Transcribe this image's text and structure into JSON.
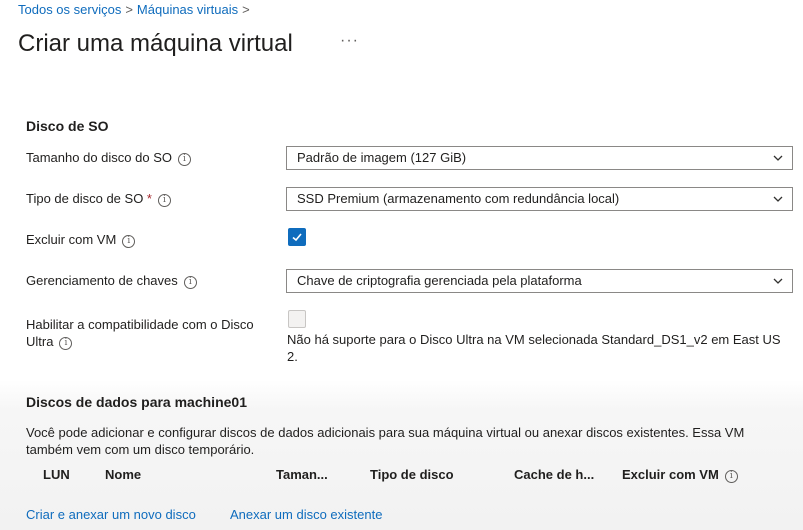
{
  "breadcrumb": [
    "Todos os serviços",
    "Máquinas virtuais"
  ],
  "page": {
    "title": "Criar uma máquina virtual",
    "more": "···"
  },
  "os_disk": {
    "section_title": "Disco de SO",
    "size_label": "Tamanho do disco do SO",
    "size_value": "Padrão de imagem (127 GiB)",
    "type_label": "Tipo de disco de SO",
    "type_value": "SSD Premium (armazenamento com redundância local)",
    "delete_label": "Excluir com VM",
    "delete_checked": true,
    "key_label": "Gerenciamento de chaves",
    "key_value": "Chave de criptografia gerenciada pela plataforma",
    "ultra_label": "Habilitar a compatibilidade com o Disco Ultra",
    "ultra_checked": false,
    "ultra_note": "Não há suporte para o Disco Ultra na VM selecionada Standard_DS1_v2 em East US 2."
  },
  "data_disks": {
    "section_title": "Discos de dados para machine01",
    "description": "Você pode adicionar e configurar discos de dados adicionais para sua máquina virtual ou anexar discos existentes. Essa VM também vem com um disco temporário.",
    "columns": [
      "LUN",
      "Nome",
      "Taman...",
      "Tipo de disco",
      "Cache de h...",
      "Excluir com VM"
    ],
    "create_link": "Criar e anexar um novo disco",
    "attach_link": "Anexar um disco existente"
  },
  "colors": {
    "accent": "#0f6cbd",
    "required": "#a4262c"
  },
  "icons": {
    "info": "info-icon",
    "chevron": "chevron-down-icon",
    "check": "checkmark-icon"
  }
}
